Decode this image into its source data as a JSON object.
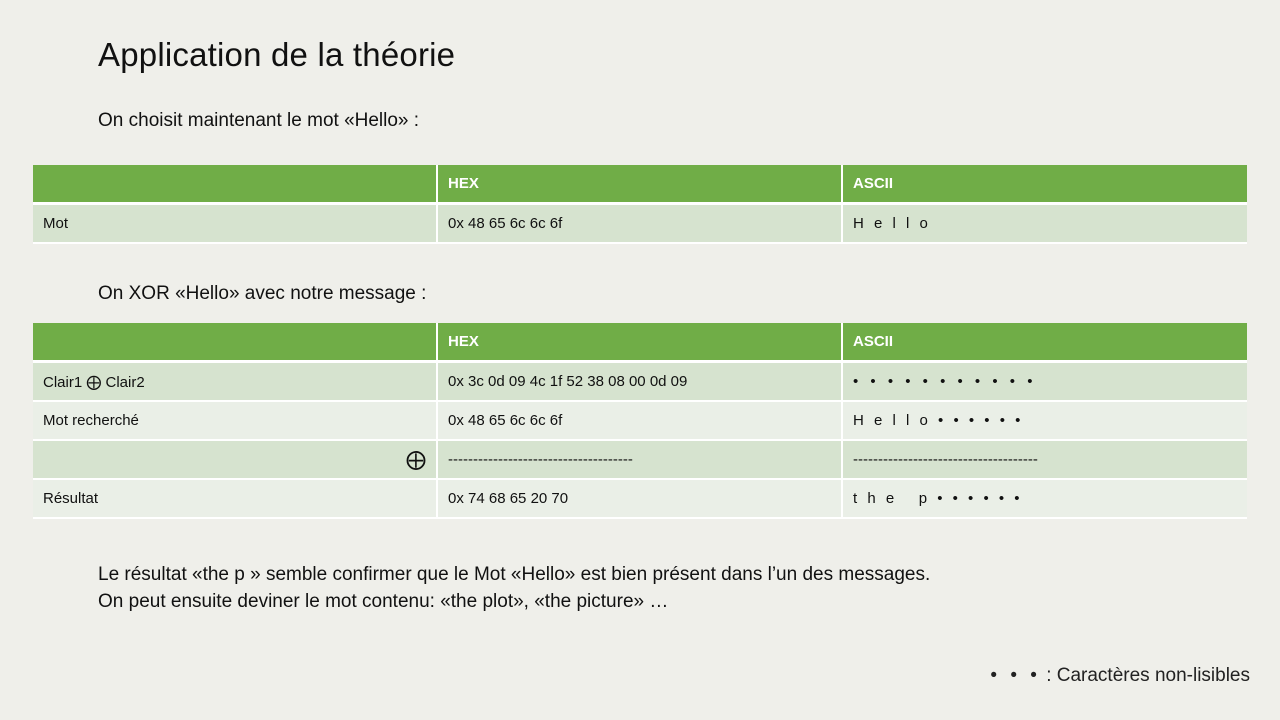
{
  "title": "Application de la théorie",
  "intro1": "On choisit maintenant le mot «Hello» :",
  "table1": {
    "headers": [
      "",
      "HEX",
      "ASCII"
    ],
    "rows": [
      [
        "Mot",
        "0x 48 65 6c 6c 6f",
        "H e l l o"
      ]
    ]
  },
  "intro2": "On XOR «Hello» avec notre message :",
  "table2": {
    "headers": [
      "",
      "HEX",
      "ASCII"
    ],
    "rows": [
      [
        "Clair1 ⨁ Clair2",
        "0x 3c 0d 09 4c 1f 52 38 08 00 0d 09",
        "• • • • • • • • • • •"
      ],
      [
        "Mot recherché",
        "0x 48 65 6c 6c 6f",
        "H e l l o • • • • • •"
      ],
      [
        "⨁",
        "-------------------------------------",
        "-------------------------------------"
      ],
      [
        "Résultat",
        "0x 74 68 65 20 70",
        "t h e   p • • • • • •"
      ]
    ]
  },
  "conclusion": {
    "line1": "Le résultat «the p » semble confirmer que le Mot «Hello» est bien présent dans l’un des messages.",
    "line2": "On peut ensuite deviner le mot contenu: «the plot», «the picture» …"
  },
  "legend": {
    "dots": "• • •",
    "text": ": Caractères non-lisibles"
  },
  "colors": {
    "header_green": "#70ad47",
    "row_dark": "#d6e3cf",
    "row_light": "#eaefe7",
    "background": "#efefea"
  }
}
